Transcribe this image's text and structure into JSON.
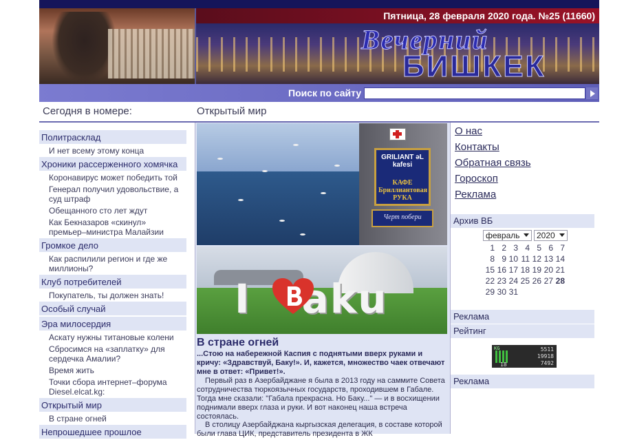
{
  "header": {
    "date": "Пятница, 28 февраля 2020 года. №25 (11660)",
    "logo_line1": "Вечерний",
    "logo_line2": "БИШКЕК"
  },
  "search": {
    "label": "Поиск по сайту",
    "placeholder": ""
  },
  "sections": {
    "left": "Сегодня в номере:",
    "middle": "Открытый мир"
  },
  "sidebar": [
    {
      "label": "Политрасклад",
      "items": [
        "И нет всему этому конца"
      ]
    },
    {
      "label": "Хроники рассерженного хомячка",
      "items": [
        "Коронавирус может победить той",
        "Генерал получил удовольствие, а суд штраф",
        "Обещанного сто лет ждут",
        "Как Бекназаров «скинул» премьер–министра Малайзии"
      ]
    },
    {
      "label": "Громкое дело",
      "items": [
        "Как распилили регион и где же миллионы?"
      ]
    },
    {
      "label": "Клуб потребителей",
      "items": [
        "Покупатель, ты должен знать!"
      ]
    },
    {
      "label": "Особый случай",
      "items": []
    },
    {
      "label": "Эра милосердия",
      "items": [
        "Аскату нужны титановые колени",
        "Сбросимся на «заплатку» для сердечка Амалии?",
        "Время жить",
        "Точки сбора интернет–форума Diesel.elcat.kg:"
      ]
    },
    {
      "label": "Открытый мир",
      "items": [
        "В стране огней"
      ]
    },
    {
      "label": "Непрошедшее прошлое",
      "items": []
    }
  ],
  "photo": {
    "sign_line1": "GRILIANT əL kafesi",
    "sign_line2": "КАФЕ Бриллиантовая РУКА",
    "sign_small": "Черт побери",
    "ibaku_pre": "I",
    "ibaku_post": "aku"
  },
  "article": {
    "title": "В стране огней",
    "lead": "...Стою на набережной Каспия с поднятыми вверх руками и кричу: «Здравствуй, Баку!». И, кажется, множество чаек отвечают мне в ответ: «Привет!».",
    "p1": "Первый раз в Азербайджане я была в 2013 году на саммите Совета сотрудничества тюркоязычных государств, проходившем в Габале. Тогда мне сказали: \"Габала прекрасна. Но Баку...\" — и в восхищении поднимали вверх глаза и руки. И вот наконец наша встреча состоялась.",
    "p2": "В столицу Азербайджана кыргызская делегация, в составе которой были глава ЦИК, представитель президента в ЖК"
  },
  "right": {
    "links": [
      "О нас",
      "Контакты",
      "Обратная связь",
      "Гороскоп",
      "Реклама"
    ],
    "archive_label": "Архив ВБ",
    "month": "февраль",
    "year": "2020",
    "calendar": [
      [
        "1",
        "2",
        "3",
        "4",
        "5",
        "6",
        "7"
      ],
      [
        "8",
        "9",
        "10",
        "11",
        "12",
        "13",
        "14"
      ],
      [
        "15",
        "16",
        "17",
        "18",
        "19",
        "20",
        "21"
      ],
      [
        "22",
        "23",
        "24",
        "25",
        "26",
        "27",
        "28"
      ],
      [
        "29",
        "30",
        "31",
        "",
        "",
        "",
        ""
      ]
    ],
    "calendar_bold": "28",
    "ads_label": "Реклама",
    "rating_label": "Рейтинг",
    "ads_label2": "Реклама",
    "counter": {
      "brand": "KG",
      "n1": "5511",
      "n2": "19918",
      "n3": "7492",
      "n4": "18"
    }
  }
}
